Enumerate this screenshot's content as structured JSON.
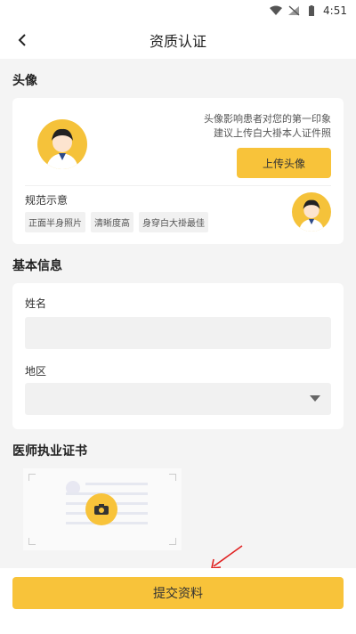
{
  "status_bar": {
    "time": "4:51"
  },
  "app_bar": {
    "title": "资质认证"
  },
  "avatar_section": {
    "title": "头像",
    "tip_line1": "头像影响患者对您的第一印象",
    "tip_line2": "建议上传白大褂本人证件照",
    "upload_label": "上传头像",
    "spec_title": "规范示意",
    "spec_tags": [
      "正面半身照片",
      "清晰度高",
      "身穿白大褂最佳"
    ]
  },
  "basic_info": {
    "title": "基本信息",
    "name_label": "姓名",
    "name_value": "",
    "region_label": "地区",
    "region_value": ""
  },
  "license_section": {
    "title": "医师执业证书"
  },
  "footer": {
    "submit_label": "提交资料"
  },
  "colors": {
    "accent": "#f8c33a",
    "annotation_arrow": "#e02020"
  },
  "icons": [
    "back-arrow-icon",
    "wifi-icon",
    "signal-icon",
    "battery-icon",
    "camera-icon",
    "dropdown-icon"
  ]
}
